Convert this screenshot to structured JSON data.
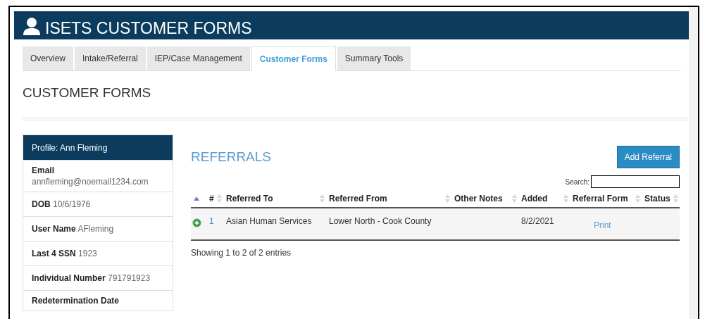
{
  "header": {
    "title": "ISETS CUSTOMER FORMS"
  },
  "tabs": [
    {
      "label": "Overview",
      "selected": false
    },
    {
      "label": "Intake/Referral",
      "selected": false
    },
    {
      "label": "IEP/Case Management",
      "selected": false
    },
    {
      "label": "Customer Forms",
      "selected": true
    },
    {
      "label": "Summary Tools",
      "selected": false
    }
  ],
  "page_heading": "CUSTOMER FORMS",
  "profile": {
    "title": "Profile: Ann Fleming",
    "fields": [
      {
        "label": "Email",
        "value": "annfleming@noemail1234.com",
        "stacked": true
      },
      {
        "label": "DOB",
        "value": "10/6/1976",
        "stacked": false
      },
      {
        "label": "User Name",
        "value": "AFleming",
        "stacked": false
      },
      {
        "label": "Last 4 SSN",
        "value": "1923",
        "stacked": false
      },
      {
        "label": "Individual Number",
        "value": "791791923",
        "stacked": false
      },
      {
        "label": "Redetermination Date",
        "stacked": true
      }
    ]
  },
  "referrals": {
    "title": "REFERRALS",
    "add_button": "Add Referral",
    "search_label": "Search:",
    "columns": [
      {
        "sorted_ascending": true
      },
      {
        "label": "#",
        "sorted_ascending": false
      },
      {
        "label": "Referred To",
        "sorted_ascending": false
      },
      {
        "label": "Referred From",
        "sorted_ascending": false
      },
      {
        "label": "Other Notes",
        "sorted_ascending": false
      },
      {
        "label": "Added",
        "sorted_ascending": false
      },
      {
        "label": "Referral Form",
        "sorted_ascending": false
      },
      {
        "label": "Status",
        "sorted_ascending": false
      }
    ],
    "rows": [
      {
        "number": "1",
        "referred_to": "Asian Human Services",
        "referred_from": "Lower North - Cook County",
        "added": "8/2/2021",
        "form_link": "Print"
      }
    ],
    "info": "Showing 1 to 2 of 2 entries"
  }
}
